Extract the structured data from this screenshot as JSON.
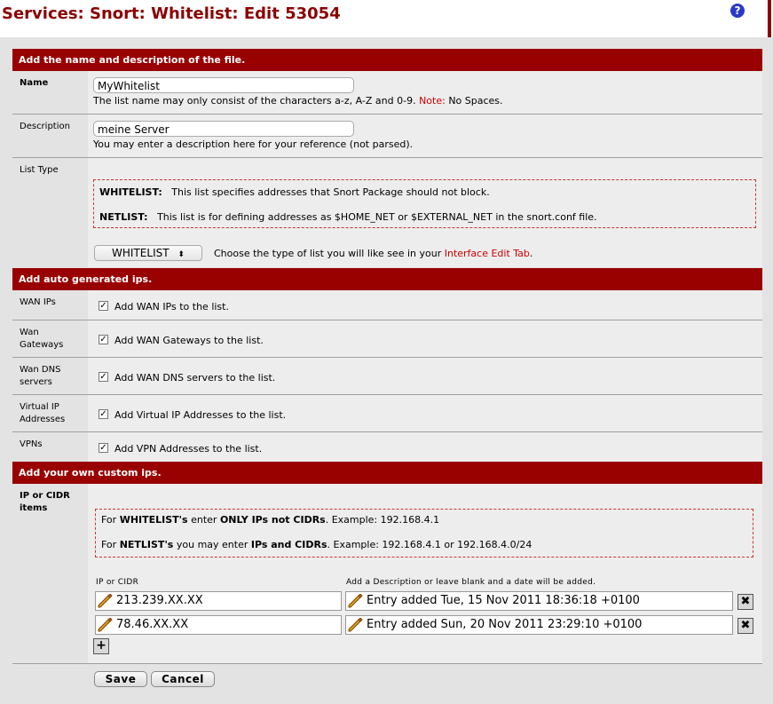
{
  "header": {
    "title": "Services: Snort: Whitelist: Edit 53054",
    "help_icon": "?"
  },
  "sections": {
    "name_desc": "Add the name and description of the file.",
    "auto": "Add auto generated ips.",
    "custom": "Add your own custom ips."
  },
  "name": {
    "label": "Name",
    "value": "MyWhitelist",
    "hint_main": "The list name may only consist of the characters a-z, A-Z and 0-9.",
    "hint_note": "Note:",
    "hint_tail": "No Spaces."
  },
  "description": {
    "label": "Description",
    "value": "meine Server",
    "hint": "You may enter a description here for your reference (not parsed)."
  },
  "list_type": {
    "label": "List Type",
    "info1_label": "WHITELIST:",
    "info1_text": "This list specifies addresses that Snort Package should not block.",
    "info2_label": "NETLIST:",
    "info2_text": "This list is for defining addresses as $HOME_NET or $EXTERNAL_NET in the snort.conf file.",
    "selected": "WHITELIST",
    "hint_pre": "Choose the type of list you will like see in your",
    "hint_link": "Interface Edit Tab",
    "hint_end": "."
  },
  "auto_rows": [
    {
      "label": "WAN IPs",
      "text": "Add WAN IPs to the list.",
      "checked": true
    },
    {
      "label": "Wan Gateways",
      "text": "Add WAN Gateways to the list.",
      "checked": true
    },
    {
      "label": "Wan DNS servers",
      "text": "Add WAN DNS servers to the list.",
      "checked": true
    },
    {
      "label": "Virtual IP Addresses",
      "text": "Add Virtual IP Addresses to the list.",
      "checked": true
    },
    {
      "label": "VPNs",
      "text": "Add VPN Addresses to the list.",
      "checked": true
    }
  ],
  "custom": {
    "label": "IP or CIDR items",
    "info1_pre": "For",
    "info1_b1": "WHITELIST's",
    "info1_mid": "enter",
    "info1_b2": "ONLY IPs not CIDRs",
    "info1_tail": ". Example: 192.168.4.1",
    "info2_pre": "For",
    "info2_b1": "NETLIST's",
    "info2_mid": "you may enter",
    "info2_b2": "IPs and CIDRs",
    "info2_tail": ". Example: 192.168.4.1 or 192.168.4.0/24",
    "col_ip": "IP or CIDR",
    "col_desc": "Add a Description or leave blank and a date will be added.",
    "entries": [
      {
        "ip": "213.239.XX.XX",
        "desc": "Entry added Tue, 15 Nov 2011 18:36:18 +0100"
      },
      {
        "ip": "78.46.XX.XX",
        "desc": "Entry added Sun, 20 Nov 2011 23:29:10 +0100"
      }
    ]
  },
  "buttons": {
    "save": "Save",
    "cancel": "Cancel"
  },
  "colors": {
    "accent": "#990000",
    "title": "#8b0000",
    "note": "#cc0000",
    "help": "#2a39c8"
  }
}
